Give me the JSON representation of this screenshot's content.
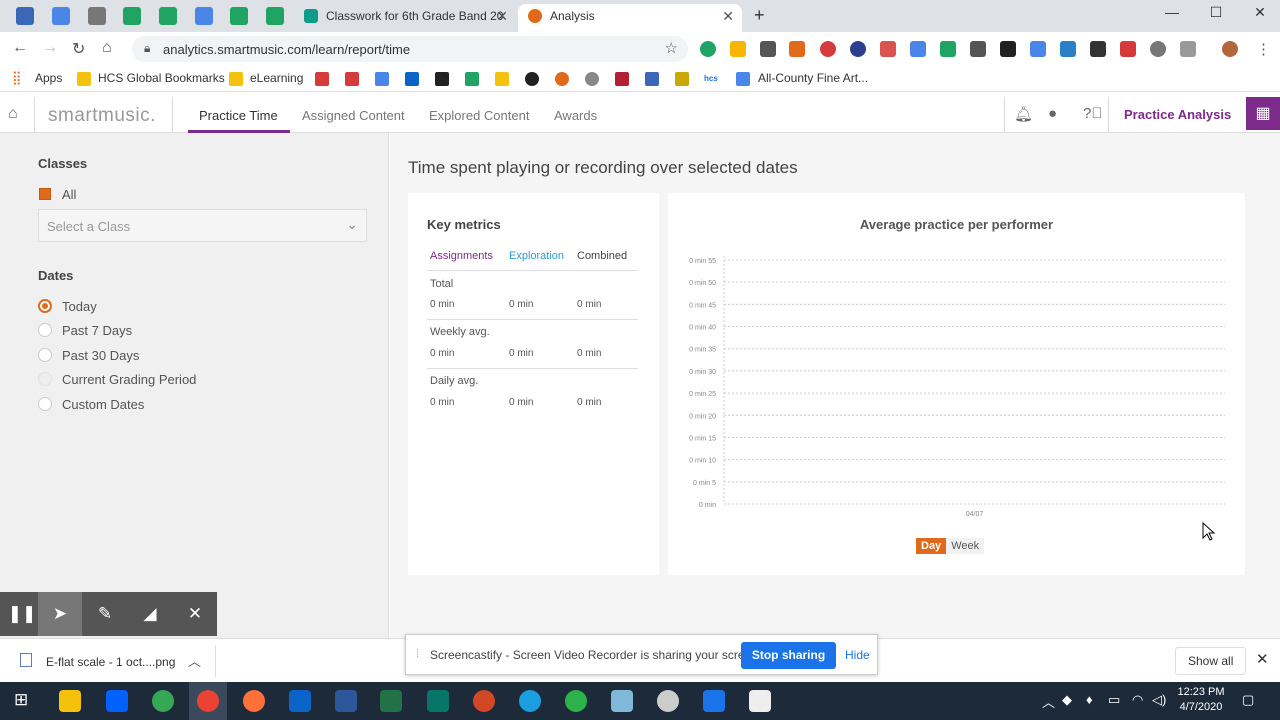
{
  "browser": {
    "tabs": [
      {
        "title": "Classwork for 6th Grade Band 20",
        "active": false
      },
      {
        "title": "Analysis",
        "active": true
      }
    ],
    "new_tab": "+",
    "window_controls": {
      "minimize": "—",
      "maximize": "☐",
      "close": "✕"
    },
    "url": "analytics.smartmusic.com/learn/report/time",
    "bookmarks": [
      {
        "label": "Apps"
      },
      {
        "label": "HCS Global Bookmarks"
      },
      {
        "label": "eLearning"
      },
      {
        "label": "All-County Fine Art..."
      }
    ],
    "bookmark_icons": [
      "gmail-icon",
      "gmail-icon",
      "calendar-icon",
      "outlook-icon",
      "pdf-icon",
      "drive-icon",
      "drive-icon",
      "app-icon",
      "smartmusic-icon",
      "apple-icon",
      "flag-icon",
      "calendar-icon",
      "classroom-icon",
      "hcs-icon",
      "sign-icon"
    ]
  },
  "app": {
    "logo": "smartmusic.",
    "nav": [
      {
        "label": "Practice Time",
        "active": true
      },
      {
        "label": "Assigned Content",
        "active": false
      },
      {
        "label": "Explored Content",
        "active": false
      },
      {
        "label": "Awards",
        "active": false
      }
    ],
    "practice_analysis": "Practice Analysis",
    "accent_color": "#7d2b8b",
    "orange_color": "#e06a1a"
  },
  "sidebar": {
    "classes_heading": "Classes",
    "all_label": "All",
    "select_placeholder": "Select a Class",
    "dates_heading": "Dates",
    "date_options": [
      {
        "label": "Today",
        "selected": true
      },
      {
        "label": "Past 7 Days",
        "selected": false
      },
      {
        "label": "Past 30 Days",
        "selected": false
      },
      {
        "label": "Current Grading Period",
        "selected": false
      },
      {
        "label": "Custom Dates",
        "selected": false
      }
    ]
  },
  "main": {
    "heading": "Time spent playing or recording over selected dates",
    "key_metrics": {
      "title": "Key metrics",
      "columns": [
        "Assignments",
        "Exploration",
        "Combined"
      ],
      "rows": [
        {
          "label": "Total",
          "values": [
            "0 min",
            "0 min",
            "0 min"
          ]
        },
        {
          "label": "Weekly avg.",
          "values": [
            "0 min",
            "0 min",
            "0 min"
          ]
        },
        {
          "label": "Daily avg.",
          "values": [
            "0 min",
            "0 min",
            "0 min"
          ]
        }
      ]
    },
    "toggle": {
      "day": "Day",
      "week": "Week",
      "active": "Day"
    }
  },
  "chart_data": {
    "type": "bar",
    "title": "Average practice per performer",
    "categories": [
      "04/07"
    ],
    "values": [
      0
    ],
    "ylim": [
      0,
      55
    ],
    "yticks": [
      "0 min",
      "0 min 5",
      "0 min 10",
      "0 min 15",
      "0 min 20",
      "0 min 25",
      "0 min 30",
      "0 min 35",
      "0 min 40",
      "0 min 45",
      "0 min 50",
      "0 min 55"
    ],
    "grid": true
  },
  "castbar": {
    "tools": [
      "pause-icon",
      "cursor-icon",
      "pen-icon",
      "eraser-icon",
      "close-icon"
    ]
  },
  "download": {
    "filename": "E-flat scale - 1 oct....png",
    "show_all": "Show all"
  },
  "sharing": {
    "message": "Screencastify - Screen Video Recorder is sharing your screen.",
    "stop": "Stop sharing",
    "hide": "Hide"
  },
  "taskbar": {
    "time": "12:23 PM",
    "date": "4/7/2020"
  }
}
